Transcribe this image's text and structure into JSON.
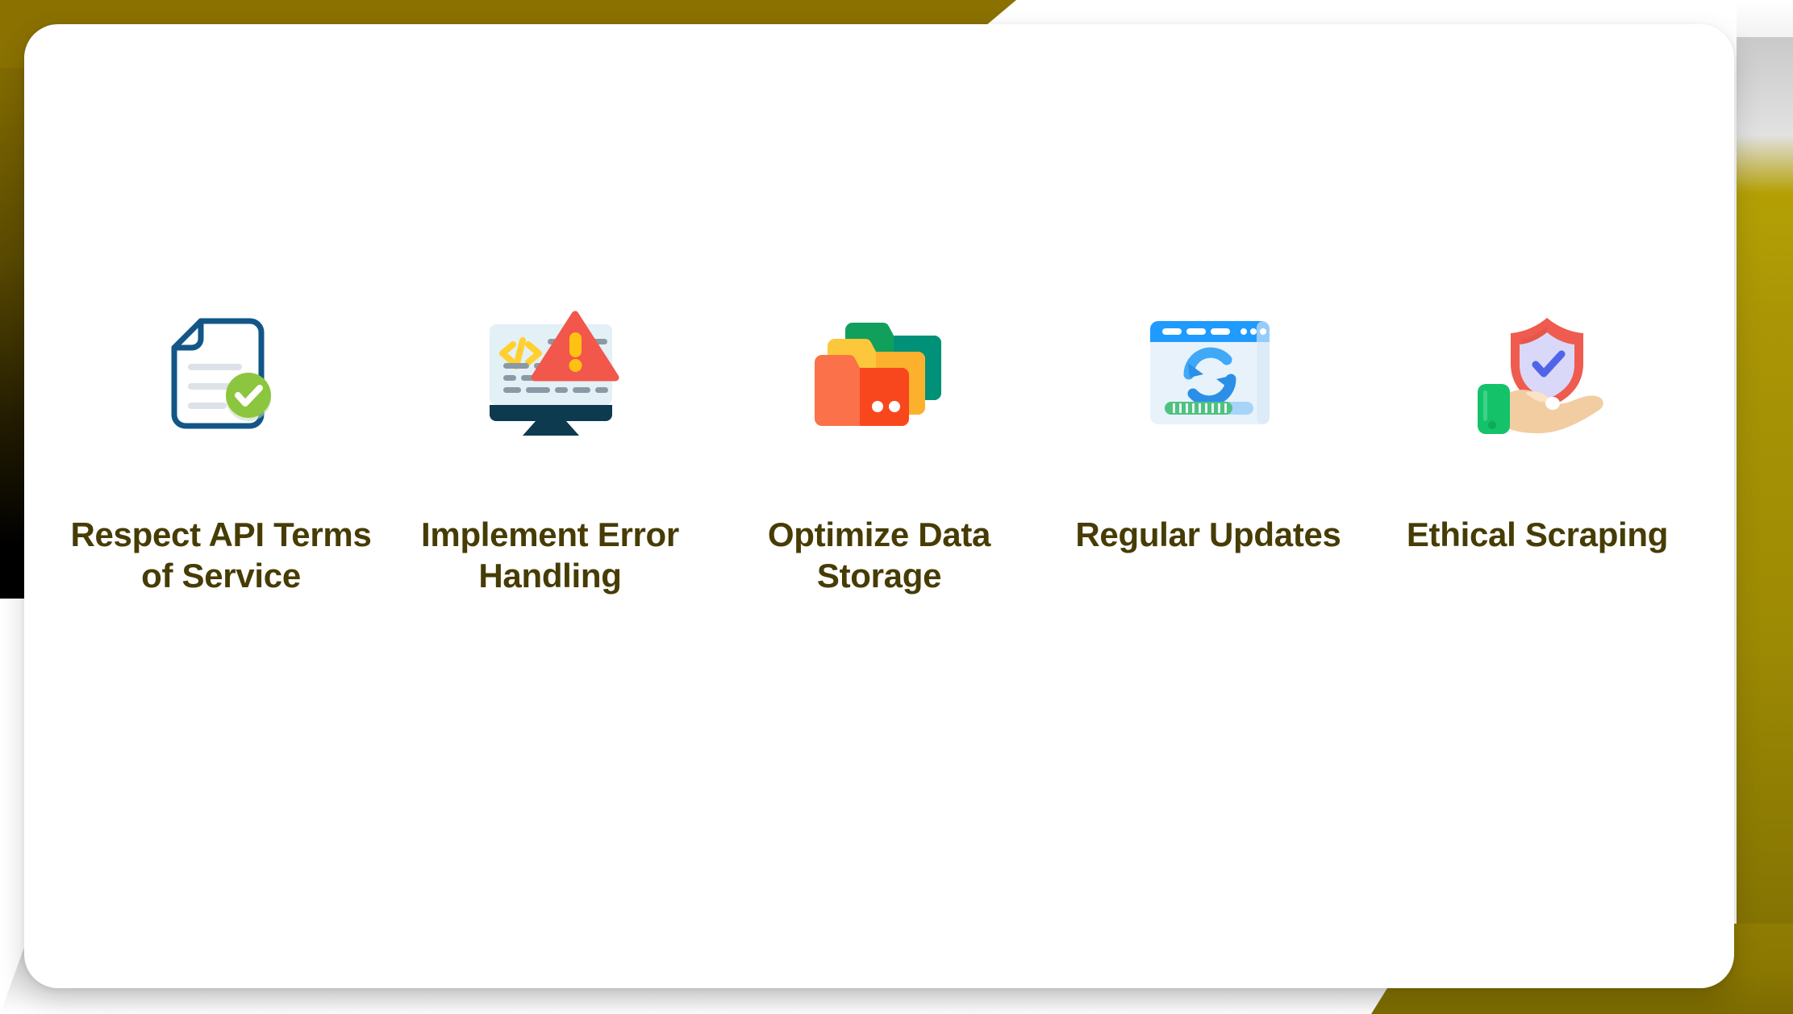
{
  "slide": {
    "card_background": "#ffffff",
    "accent_olive": "#8a7100",
    "label_color": "#463c04"
  },
  "items": [
    {
      "id": "respect-api-terms",
      "label": "Respect API Terms of Service",
      "icon_name": "document-check-icon",
      "icon_colors": {
        "outline": "#125688",
        "check_badge": "#8cc63e",
        "lines": "#dfe3e8"
      }
    },
    {
      "id": "implement-error-handling",
      "label": "Implement Error Handling",
      "icon_name": "monitor-code-warning-icon",
      "icon_colors": {
        "screen": "#e3f0f6",
        "base": "#0e3a4f",
        "code": "#ffd02f",
        "warning": "#f2574b",
        "lines": "#8a9aa5"
      }
    },
    {
      "id": "optimize-data-storage",
      "label": "Optimize Data Storage",
      "icon_name": "folders-stack-icon",
      "icon_colors": {
        "green_dark": "#009178",
        "green": "#11a05b",
        "yellow": "#fbb12d",
        "yellow_light": "#fdc73c",
        "orange": "#fb7149",
        "orange_dark": "#f9471d"
      }
    },
    {
      "id": "regular-updates",
      "label": "Regular Updates",
      "icon_name": "browser-refresh-progress-icon",
      "icon_colors": {
        "titlebar": "#1f9bff",
        "body": "#e8f2fb",
        "refresh": "#2b9bf4",
        "progress": "#4fc27f",
        "progress_track": "#a7d4f8"
      }
    },
    {
      "id": "ethical-scraping",
      "label": "Ethical Scraping",
      "icon_name": "shield-in-hand-icon",
      "icon_colors": {
        "shield_outer": "#ef5b4f",
        "shield_inner": "#d9d8f8",
        "check": "#5064e8",
        "hand": "#f2cda1",
        "sleeve": "#14c26a"
      }
    }
  ]
}
